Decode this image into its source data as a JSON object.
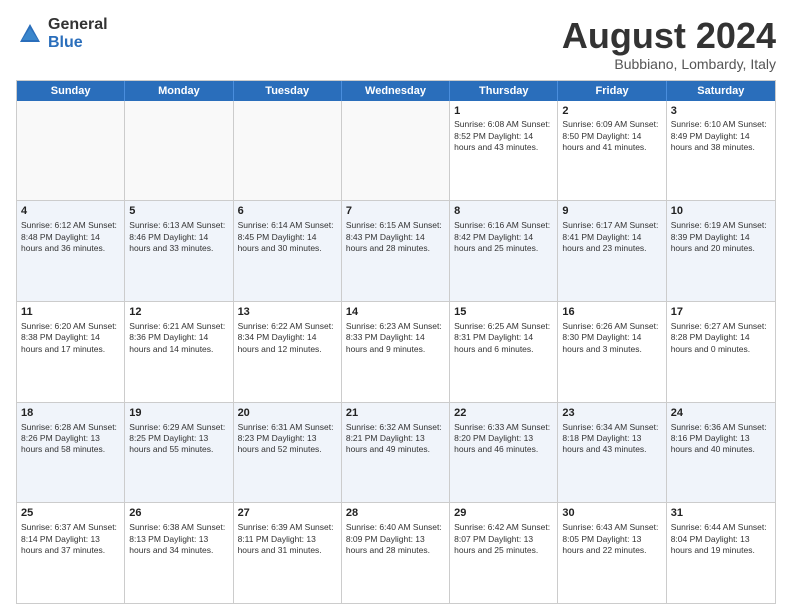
{
  "logo": {
    "general": "General",
    "blue": "Blue"
  },
  "title": "August 2024",
  "subtitle": "Bubbiano, Lombardy, Italy",
  "days": [
    "Sunday",
    "Monday",
    "Tuesday",
    "Wednesday",
    "Thursday",
    "Friday",
    "Saturday"
  ],
  "weeks": [
    [
      {
        "day": "",
        "info": ""
      },
      {
        "day": "",
        "info": ""
      },
      {
        "day": "",
        "info": ""
      },
      {
        "day": "",
        "info": ""
      },
      {
        "day": "1",
        "info": "Sunrise: 6:08 AM\nSunset: 8:52 PM\nDaylight: 14 hours and 43 minutes."
      },
      {
        "day": "2",
        "info": "Sunrise: 6:09 AM\nSunset: 8:50 PM\nDaylight: 14 hours and 41 minutes."
      },
      {
        "day": "3",
        "info": "Sunrise: 6:10 AM\nSunset: 8:49 PM\nDaylight: 14 hours and 38 minutes."
      }
    ],
    [
      {
        "day": "4",
        "info": "Sunrise: 6:12 AM\nSunset: 8:48 PM\nDaylight: 14 hours and 36 minutes."
      },
      {
        "day": "5",
        "info": "Sunrise: 6:13 AM\nSunset: 8:46 PM\nDaylight: 14 hours and 33 minutes."
      },
      {
        "day": "6",
        "info": "Sunrise: 6:14 AM\nSunset: 8:45 PM\nDaylight: 14 hours and 30 minutes."
      },
      {
        "day": "7",
        "info": "Sunrise: 6:15 AM\nSunset: 8:43 PM\nDaylight: 14 hours and 28 minutes."
      },
      {
        "day": "8",
        "info": "Sunrise: 6:16 AM\nSunset: 8:42 PM\nDaylight: 14 hours and 25 minutes."
      },
      {
        "day": "9",
        "info": "Sunrise: 6:17 AM\nSunset: 8:41 PM\nDaylight: 14 hours and 23 minutes."
      },
      {
        "day": "10",
        "info": "Sunrise: 6:19 AM\nSunset: 8:39 PM\nDaylight: 14 hours and 20 minutes."
      }
    ],
    [
      {
        "day": "11",
        "info": "Sunrise: 6:20 AM\nSunset: 8:38 PM\nDaylight: 14 hours and 17 minutes."
      },
      {
        "day": "12",
        "info": "Sunrise: 6:21 AM\nSunset: 8:36 PM\nDaylight: 14 hours and 14 minutes."
      },
      {
        "day": "13",
        "info": "Sunrise: 6:22 AM\nSunset: 8:34 PM\nDaylight: 14 hours and 12 minutes."
      },
      {
        "day": "14",
        "info": "Sunrise: 6:23 AM\nSunset: 8:33 PM\nDaylight: 14 hours and 9 minutes."
      },
      {
        "day": "15",
        "info": "Sunrise: 6:25 AM\nSunset: 8:31 PM\nDaylight: 14 hours and 6 minutes."
      },
      {
        "day": "16",
        "info": "Sunrise: 6:26 AM\nSunset: 8:30 PM\nDaylight: 14 hours and 3 minutes."
      },
      {
        "day": "17",
        "info": "Sunrise: 6:27 AM\nSunset: 8:28 PM\nDaylight: 14 hours and 0 minutes."
      }
    ],
    [
      {
        "day": "18",
        "info": "Sunrise: 6:28 AM\nSunset: 8:26 PM\nDaylight: 13 hours and 58 minutes."
      },
      {
        "day": "19",
        "info": "Sunrise: 6:29 AM\nSunset: 8:25 PM\nDaylight: 13 hours and 55 minutes."
      },
      {
        "day": "20",
        "info": "Sunrise: 6:31 AM\nSunset: 8:23 PM\nDaylight: 13 hours and 52 minutes."
      },
      {
        "day": "21",
        "info": "Sunrise: 6:32 AM\nSunset: 8:21 PM\nDaylight: 13 hours and 49 minutes."
      },
      {
        "day": "22",
        "info": "Sunrise: 6:33 AM\nSunset: 8:20 PM\nDaylight: 13 hours and 46 minutes."
      },
      {
        "day": "23",
        "info": "Sunrise: 6:34 AM\nSunset: 8:18 PM\nDaylight: 13 hours and 43 minutes."
      },
      {
        "day": "24",
        "info": "Sunrise: 6:36 AM\nSunset: 8:16 PM\nDaylight: 13 hours and 40 minutes."
      }
    ],
    [
      {
        "day": "25",
        "info": "Sunrise: 6:37 AM\nSunset: 8:14 PM\nDaylight: 13 hours and 37 minutes."
      },
      {
        "day": "26",
        "info": "Sunrise: 6:38 AM\nSunset: 8:13 PM\nDaylight: 13 hours and 34 minutes."
      },
      {
        "day": "27",
        "info": "Sunrise: 6:39 AM\nSunset: 8:11 PM\nDaylight: 13 hours and 31 minutes."
      },
      {
        "day": "28",
        "info": "Sunrise: 6:40 AM\nSunset: 8:09 PM\nDaylight: 13 hours and 28 minutes."
      },
      {
        "day": "29",
        "info": "Sunrise: 6:42 AM\nSunset: 8:07 PM\nDaylight: 13 hours and 25 minutes."
      },
      {
        "day": "30",
        "info": "Sunrise: 6:43 AM\nSunset: 8:05 PM\nDaylight: 13 hours and 22 minutes."
      },
      {
        "day": "31",
        "info": "Sunrise: 6:44 AM\nSunset: 8:04 PM\nDaylight: 13 hours and 19 minutes."
      }
    ]
  ]
}
